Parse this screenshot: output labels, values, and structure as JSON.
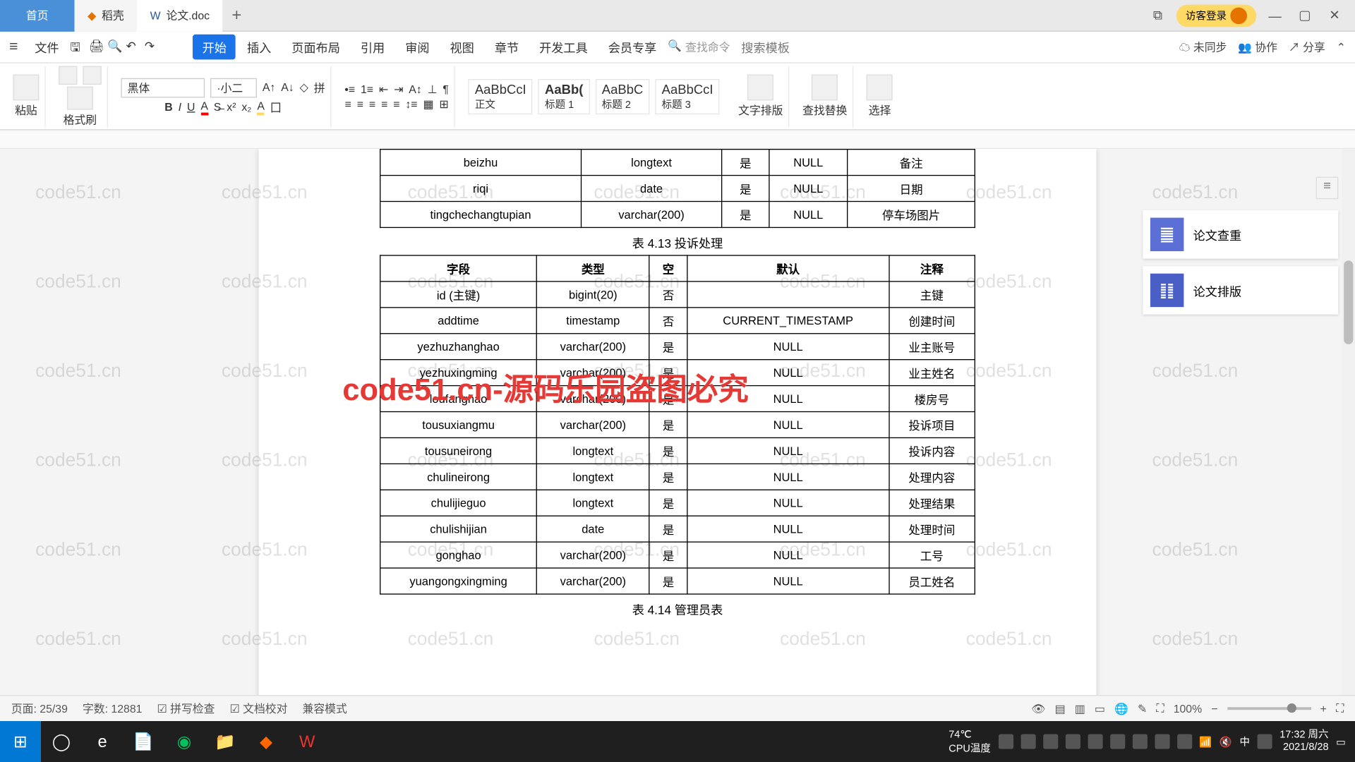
{
  "tabs": {
    "home": "首页",
    "docx": "稻壳",
    "active": "论文.doc"
  },
  "window": {
    "login": "访客登录"
  },
  "menu": {
    "file": "文件",
    "items": [
      "开始",
      "插入",
      "页面布局",
      "引用",
      "审阅",
      "视图",
      "章节",
      "开发工具",
      "会员专享"
    ],
    "search_placeholder": "查找命令",
    "search_template": "搜索模板",
    "unsync": "未同步",
    "coop": "协作",
    "share": "分享"
  },
  "ribbon": {
    "paste": "粘贴",
    "format_painter": "格式刷",
    "font_name": "黑体",
    "font_size": "·小二",
    "styles": [
      {
        "preview": "AaBbCcI",
        "label": "正文"
      },
      {
        "preview": "AaBb(",
        "label": "标题 1"
      },
      {
        "preview": "AaBbC",
        "label": "标题 2"
      },
      {
        "preview": "AaBbCcI",
        "label": "标题 3"
      }
    ],
    "outline": "文字排版",
    "find_replace": "查找替换",
    "select": "选择"
  },
  "table1": {
    "rows": [
      [
        "beizhu",
        "longtext",
        "是",
        "NULL",
        "备注"
      ],
      [
        "riqi",
        "date",
        "是",
        "NULL",
        "日期"
      ],
      [
        "tingchechangtupian",
        "varchar(200)",
        "是",
        "NULL",
        "停车场图片"
      ]
    ]
  },
  "caption1": "表 4.13  投诉处理",
  "table2": {
    "headers": [
      "字段",
      "类型",
      "空",
      "默认",
      "注释"
    ],
    "rows": [
      [
        "id (主键)",
        "bigint(20)",
        "否",
        "",
        "主键"
      ],
      [
        "addtime",
        "timestamp",
        "否",
        "CURRENT_TIMESTAMP",
        "创建时间"
      ],
      [
        "yezhuzhanghao",
        "varchar(200)",
        "是",
        "NULL",
        "业主账号"
      ],
      [
        "yezhuxingming",
        "varchar(200)",
        "是",
        "NULL",
        "业主姓名"
      ],
      [
        "loufanghao",
        "varchar(200)",
        "是",
        "NULL",
        "楼房号"
      ],
      [
        "tousuxiangmu",
        "varchar(200)",
        "是",
        "NULL",
        "投诉项目"
      ],
      [
        "tousuneirong",
        "longtext",
        "是",
        "NULL",
        "投诉内容"
      ],
      [
        "chulineirong",
        "longtext",
        "是",
        "NULL",
        "处理内容"
      ],
      [
        "chulijieguo",
        "longtext",
        "是",
        "NULL",
        "处理结果"
      ],
      [
        "chulishijian",
        "date",
        "是",
        "NULL",
        "处理时间"
      ],
      [
        "gonghao",
        "varchar(200)",
        "是",
        "NULL",
        "工号"
      ],
      [
        "yuangongxingming",
        "varchar(200)",
        "是",
        "NULL",
        "员工姓名"
      ]
    ]
  },
  "caption2": "表 4.14  管理员表",
  "side": {
    "card1": "论文查重",
    "card2": "论文排版"
  },
  "status": {
    "page": "页面: 25/39",
    "words": "字数: 12881",
    "spell": "拼写检查",
    "proof": "文档校对",
    "compat": "兼容模式",
    "zoom": "100%"
  },
  "taskbar": {
    "cpu": "CPU温度",
    "cpu_temp": "74℃",
    "time": "17:32 周六",
    "date": "2021/8/28",
    "ime": "中"
  },
  "watermark": {
    "text": "code51.cn",
    "red": "code51.cn-源码乐园盗图必究"
  }
}
